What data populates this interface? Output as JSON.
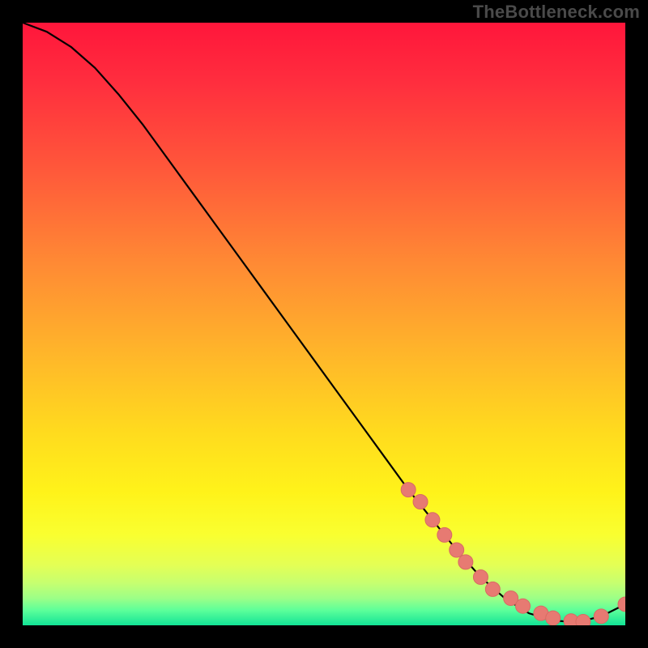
{
  "watermark": "TheBottleneck.com",
  "colors": {
    "curve": "#000000",
    "marker_fill": "#e77a72",
    "marker_stroke": "#d86b63"
  },
  "chart_data": {
    "type": "line",
    "title": "",
    "xlabel": "",
    "ylabel": "",
    "xlim": [
      0,
      100
    ],
    "ylim": [
      0,
      100
    ],
    "grid": false,
    "series": [
      {
        "name": "curve",
        "x": [
          0,
          4,
          8,
          12,
          16,
          20,
          24,
          28,
          32,
          36,
          40,
          44,
          48,
          52,
          56,
          60,
          64,
          68,
          72,
          76,
          80,
          84,
          88,
          92,
          96,
          100
        ],
        "y": [
          100,
          98.5,
          96,
          92.5,
          88,
          83,
          77.5,
          72,
          66.5,
          61,
          55.5,
          50,
          44.5,
          39,
          33.5,
          28,
          22.5,
          17.5,
          12.5,
          8,
          4.5,
          2,
          0.8,
          0.5,
          1.5,
          3.5
        ]
      }
    ],
    "markers": {
      "name": "cluster",
      "x": [
        64,
        66,
        68,
        70,
        72,
        73.5,
        76,
        78,
        81,
        83,
        86,
        88,
        91,
        93,
        96,
        100
      ],
      "y": [
        22.5,
        20.5,
        17.5,
        15,
        12.5,
        10.5,
        8,
        6,
        4.5,
        3.2,
        2,
        1.2,
        0.7,
        0.6,
        1.5,
        3.5
      ]
    }
  }
}
